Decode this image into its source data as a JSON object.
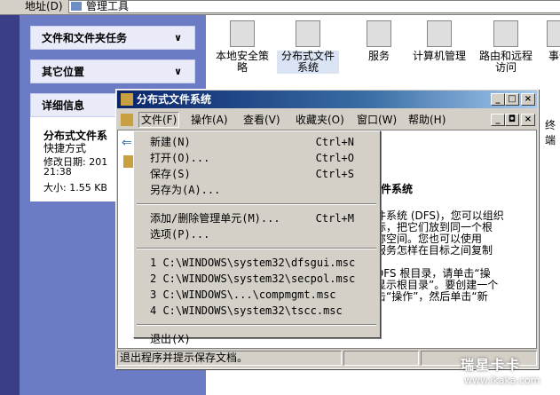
{
  "address_bar": {
    "label": "地址(D)",
    "value": "管理工具"
  },
  "task_pane": {
    "file_tasks": "文件和文件夹任务",
    "other_places": "其它位置",
    "details": {
      "header": "详细信息",
      "name": "分布式文件系",
      "type": "快捷方式",
      "modified_label": "修改日期: 201",
      "modified_time": "21:38",
      "size": "大小: 1.55 KB"
    }
  },
  "icons": [
    {
      "label": "本地安全策\n略",
      "icon": "security-policy-icon"
    },
    {
      "label": "分布式文件\n系统",
      "icon": "dfs-icon"
    },
    {
      "label": "服务",
      "icon": "services-icon"
    },
    {
      "label": "计算机管理",
      "icon": "computer-management-icon"
    },
    {
      "label": "路由和远程\n访问",
      "icon": "routing-icon"
    },
    {
      "label": "事件",
      "icon": "event-viewer-icon"
    }
  ],
  "window": {
    "title": "分布式文件系统",
    "menu": [
      "文件(F)",
      "操作(A)",
      "查看(V)",
      "收藏夹(O)",
      "窗口(W)",
      "帮助(H)"
    ],
    "content_heading": "件系统",
    "content_lines": [
      "件系统 (DFS)，您可以组织",
      "标，把它们放到同一个根",
      "称空间。您也可以使用",
      "服务怎样在目标之间复制",
      "",
      "DFS 根目录，请单击“操",
      "显示根目录”。要创建一个",
      "击“操作”，然后单击“新"
    ],
    "status": "退出程序并提示保存文档。"
  },
  "file_menu": {
    "group1": [
      {
        "label": "新建(N)",
        "shortcut": "Ctrl+N"
      },
      {
        "label": "打开(O)...",
        "shortcut": "Ctrl+O"
      },
      {
        "label": "保存(S)",
        "shortcut": "Ctrl+S"
      },
      {
        "label": "另存为(A)...",
        "shortcut": ""
      }
    ],
    "group2": [
      {
        "label": "添加/删除管理单元(M)...",
        "shortcut": "Ctrl+M"
      },
      {
        "label": "选项(P)...",
        "shortcut": ""
      }
    ],
    "recent": [
      "1 C:\\WINDOWS\\system32\\dfsgui.msc",
      "2 C:\\WINDOWS\\system32\\secpol.msc",
      "3 C:\\WINDOWS\\...\\compmgmt.msc",
      "4 C:\\WINDOWS\\system32\\tscc.msc"
    ],
    "exit": "退出(X)"
  },
  "right_edge_text": [
    "终端"
  ],
  "watermark": {
    "brand": "瑞星卡卡",
    "url": "www.ikaka.com"
  }
}
